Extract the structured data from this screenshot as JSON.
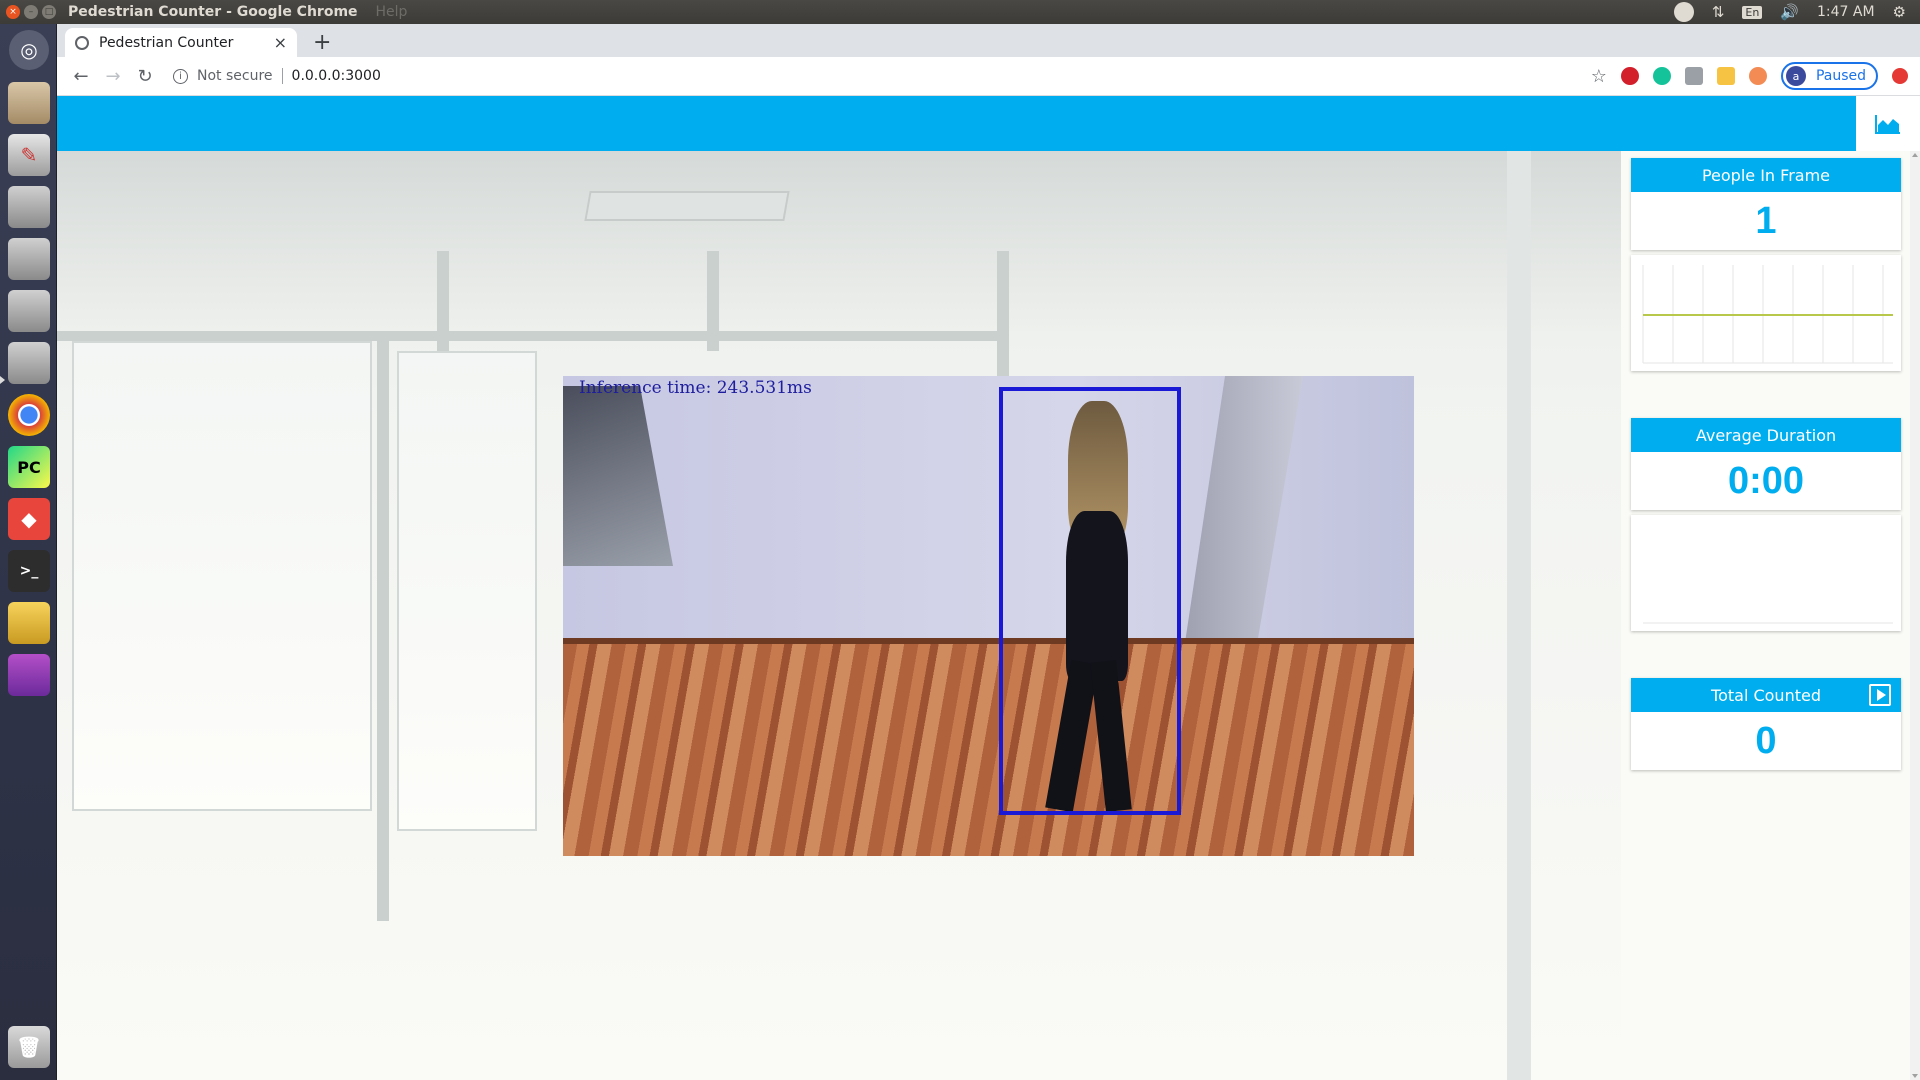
{
  "os": {
    "window_title": "Pedestrian Counter - Google Chrome",
    "menu_help": "Help",
    "keyboard_layout": "En",
    "clock": "1:47 AM"
  },
  "browser": {
    "tab_title": "Pedestrian Counter",
    "tab_close": "×",
    "new_tab": "+",
    "security_label": "Not secure",
    "url": "0.0.0.0:3000",
    "profile_initial": "a",
    "profile_status": "Paused"
  },
  "app": {
    "header_color": "#00aeef",
    "video": {
      "inference_text": "Inference time: 243.531ms",
      "bbox_color": "#1a1ad6"
    },
    "stats": {
      "people_in_frame_label": "People In Frame",
      "people_in_frame_value": "1",
      "average_duration_label": "Average Duration",
      "average_duration_value": "0:00",
      "total_counted_label": "Total Counted",
      "total_counted_value": "0"
    },
    "graph": {
      "line_color": "#b7c84a"
    }
  }
}
